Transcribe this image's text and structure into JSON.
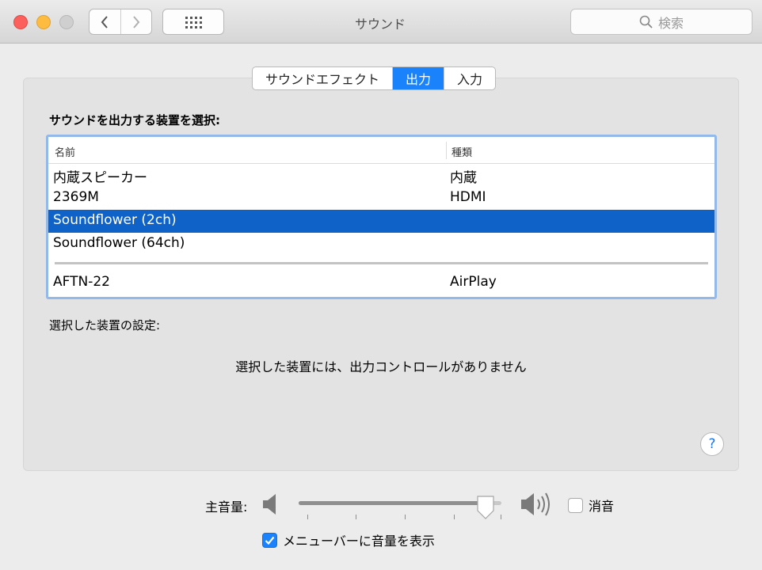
{
  "window": {
    "title": "サウンド",
    "search_placeholder": "検索"
  },
  "tabs": [
    {
      "label": "サウンドエフェクト",
      "active": false
    },
    {
      "label": "出力",
      "active": true
    },
    {
      "label": "入力",
      "active": false
    }
  ],
  "output": {
    "heading": "サウンドを出力する装置を選択:",
    "columns": {
      "name": "名前",
      "type": "種類"
    },
    "devices": [
      {
        "name": "内蔵スピーカー",
        "type": "内蔵",
        "selected": false
      },
      {
        "name": "2369M",
        "type": "HDMI",
        "selected": false
      },
      {
        "name": "Soundflower (2ch)",
        "type": "",
        "selected": true
      },
      {
        "name": "Soundflower (64ch)",
        "type": "",
        "selected": false
      },
      {
        "name": "AFTN-22",
        "type": "AirPlay",
        "selected": false
      }
    ],
    "settings_heading": "選択した装置の設定:",
    "no_controls_message": "選択した装置には、出力コントロールがありません",
    "help_label": "?"
  },
  "volume": {
    "label": "主音量:",
    "level": 0.92,
    "mute_label": "消音",
    "muted": false,
    "show_in_menubar_label": "メニューバーに音量を表示",
    "show_in_menubar": true
  },
  "colors": {
    "accent": "#1a82fb",
    "selection": "#0f62c8",
    "table_focus_ring": "#93b8ea"
  }
}
